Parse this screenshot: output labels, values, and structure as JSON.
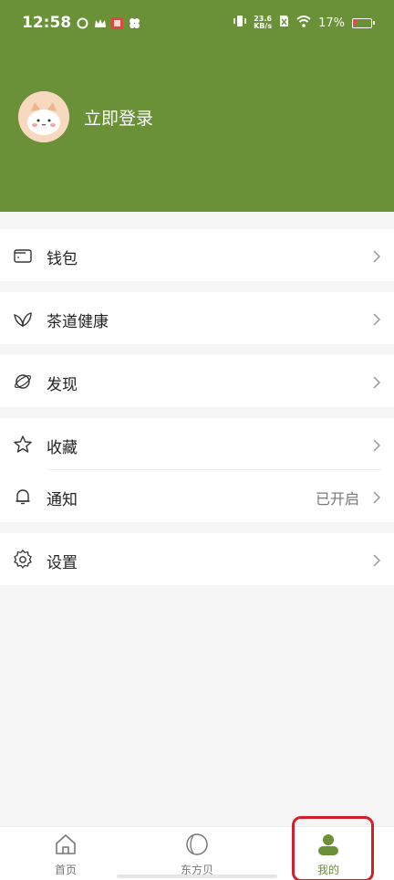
{
  "status_bar": {
    "time": "12:58",
    "net_speed_value": "23.6",
    "net_speed_unit": "KB/s",
    "battery_percent": "17%"
  },
  "profile": {
    "login_label": "立即登录"
  },
  "menu": {
    "wallet": "钱包",
    "tea_health": "茶道健康",
    "discover": "发现",
    "favorites": "收藏",
    "notifications": "通知",
    "notifications_value": "已开启",
    "settings": "设置"
  },
  "tabbar": {
    "home": "首页",
    "dongfangbei": "东方贝",
    "mine": "我的"
  },
  "colors": {
    "brand": "#6a9038",
    "highlight": "#d0202a"
  }
}
